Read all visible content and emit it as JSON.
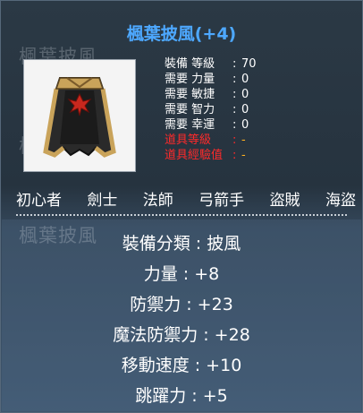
{
  "item": {
    "title": "楓葉披風(+4)",
    "ghost_name": "楓葉披風",
    "ghost_partial": "楓"
  },
  "stats": [
    {
      "label": "裝備 等級",
      "colon": ":",
      "value": "70"
    },
    {
      "label": "需要 力量",
      "colon": ":",
      "value": "0"
    },
    {
      "label": "需要 敏捷",
      "colon": ":",
      "value": "0"
    },
    {
      "label": "需要 智力",
      "colon": ":",
      "value": "0"
    },
    {
      "label": "需要 幸運",
      "colon": ":",
      "value": "0"
    },
    {
      "label": "道具等級",
      "colon": ":",
      "value": "-"
    },
    {
      "label": "道具經驗值",
      "colon": ":",
      "value": "-"
    }
  ],
  "jobs": [
    "初心者",
    "劍士",
    "法師",
    "弓箭手",
    "盜賊",
    "海盜"
  ],
  "properties": [
    "裝備分類 : 披風",
    "力量 : +8",
    "防禦力 : +23",
    "魔法防禦力 : +28",
    "移動速度 : +10",
    "跳躍力 : +5"
  ],
  "colors": {
    "title": "#4da8ff",
    "required_label_red": "#ff2a2a",
    "dash_value": "#ffb020",
    "text": "#ffffff"
  },
  "icon": "maple-cape-icon"
}
